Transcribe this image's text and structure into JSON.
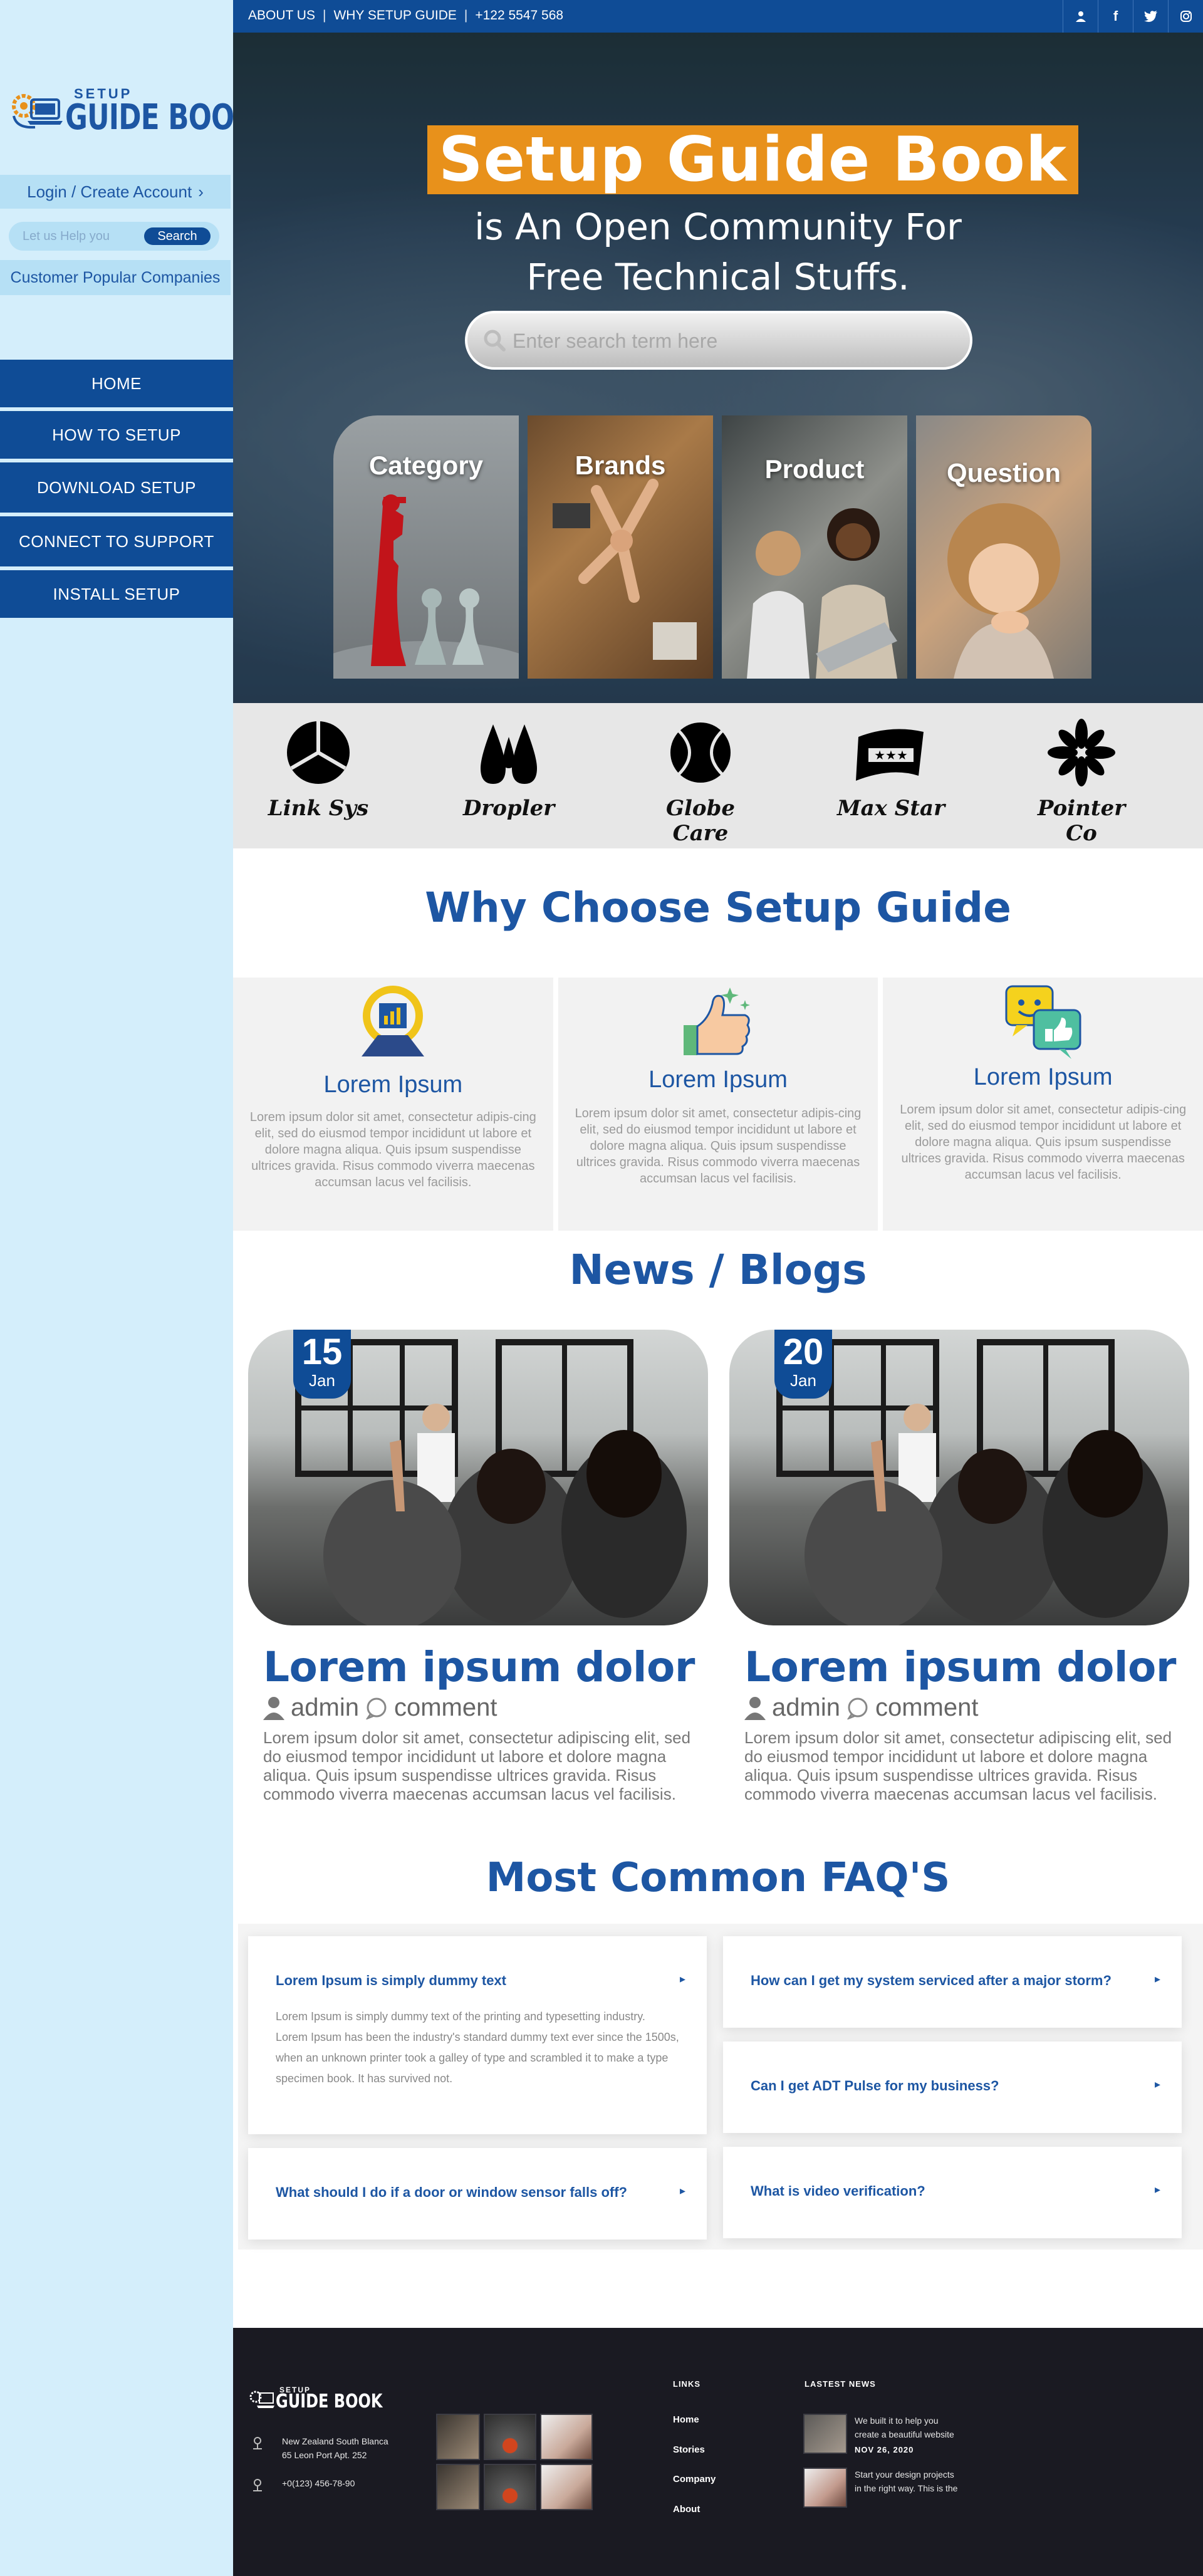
{
  "brand": {
    "small": "SETUP",
    "big": "GUIDE BOOK"
  },
  "sidebar": {
    "login": "Login / Create Account",
    "search_placeholder": "Let us Help you",
    "search_button": "Search",
    "companies": "Customer Popular Companies",
    "nav": [
      "HOME",
      "HOW TO SETUP",
      "DOWNLOAD SETUP",
      "CONNECT TO SUPPORT",
      "INSTALL SETUP"
    ]
  },
  "topbar": {
    "links": [
      "ABOUT US",
      "WHY SETUP GUIDE",
      "+122 5547 568"
    ],
    "social_icons": [
      "user-icon",
      "facebook-icon",
      "twitter-icon",
      "instagram-icon"
    ]
  },
  "hero": {
    "title": "Setup Guide Book",
    "subtitle_line1": "is An Open Community For",
    "subtitle_line2": "Free Technical Stuffs.",
    "search_placeholder": "Enter search term here",
    "cards": [
      "Category",
      "Brands",
      "Product",
      "Question"
    ]
  },
  "brands": [
    "Link Sys",
    "Dropler",
    "Globe Care",
    "Max Star",
    "Pointer Co"
  ],
  "why": {
    "title": "Why Choose Setup Guide",
    "features": [
      {
        "title": "Lorem Ipsum",
        "text": "Lorem ipsum dolor sit amet, consectetur adipis-cing elit, sed do eiusmod tempor incididunt ut labore et dolore magna aliqua. Quis ipsum suspendisse ultrices gravida. Risus commodo viverra maecenas accumsan lacus vel facilisis."
      },
      {
        "title": "Lorem Ipsum",
        "text": "Lorem ipsum dolor sit amet, consectetur adipis-cing elit, sed do eiusmod tempor incididunt ut labore et dolore magna aliqua. Quis ipsum suspendisse ultrices gravida. Risus commodo viverra maecenas accumsan lacus vel facilisis."
      },
      {
        "title": "Lorem Ipsum",
        "text": "Lorem ipsum dolor sit amet, consectetur adipis-cing elit, sed do eiusmod tempor incididunt ut labore et dolore magna aliqua. Quis ipsum suspendisse ultrices gravida. Risus commodo viverra maecenas accumsan lacus vel facilisis."
      }
    ]
  },
  "news": {
    "title": "News / Blogs",
    "posts": [
      {
        "day": "15",
        "month": "Jan",
        "title": "Lorem ipsum dolor",
        "author": "admin",
        "comment": "comment",
        "text": "Lorem ipsum dolor sit amet, consectetur adipiscing elit, sed do eiusmod tempor incididunt ut labore et dolore magna aliqua. Quis ipsum suspendisse ultrices gravida. Risus commodo viverra maecenas accumsan lacus vel facilisis."
      },
      {
        "day": "20",
        "month": "Jan",
        "title": "Lorem ipsum dolor",
        "author": "admin",
        "comment": "comment",
        "text": "Lorem ipsum dolor sit amet, consectetur adipiscing elit, sed do eiusmod tempor incididunt ut labore et dolore magna aliqua. Quis ipsum suspendisse ultrices gravida. Risus commodo viverra maecenas accumsan lacus vel facilisis."
      }
    ]
  },
  "faq": {
    "title": "Most Common FAQ'S",
    "items": [
      {
        "q": "Lorem Ipsum is simply dummy text",
        "a": "Lorem Ipsum is simply dummy text of the printing and typesetting industry. Lorem Ipsum has been the industry's standard dummy text ever since the 1500s, when an unknown printer took a galley of type and scrambled it to make a type specimen book. It has survived not."
      },
      {
        "q": "How can I get my system serviced after a major storm?"
      },
      {
        "q": "Can I get ADT Pulse for my business?"
      },
      {
        "q": "What should I do if a door or window sensor falls off?"
      },
      {
        "q": "What is video verification?"
      }
    ]
  },
  "footer": {
    "logo_small": "SETUP",
    "logo_big": "GUIDE BOOK",
    "address1": "New Zealand South Blanca",
    "address2": "65 Leon Port Apt. 252",
    "phone": "+0(123) 456-78-90",
    "links_title": "LINKS",
    "links": [
      "Home",
      "Stories",
      "Company",
      "About"
    ],
    "news_title": "LASTEST NEWS",
    "news": [
      {
        "line1": "We built it to help you",
        "line2": "create a beautiful website",
        "date": "NOV 26, 2020"
      },
      {
        "line1": "Start your design projects",
        "line2": "in the right way. This is the"
      }
    ]
  },
  "colors": {
    "primary": "#0f4c96",
    "accent": "#e8911b",
    "sidebar_bg": "#d4eefb",
    "footer_bg": "#1a1a22"
  }
}
